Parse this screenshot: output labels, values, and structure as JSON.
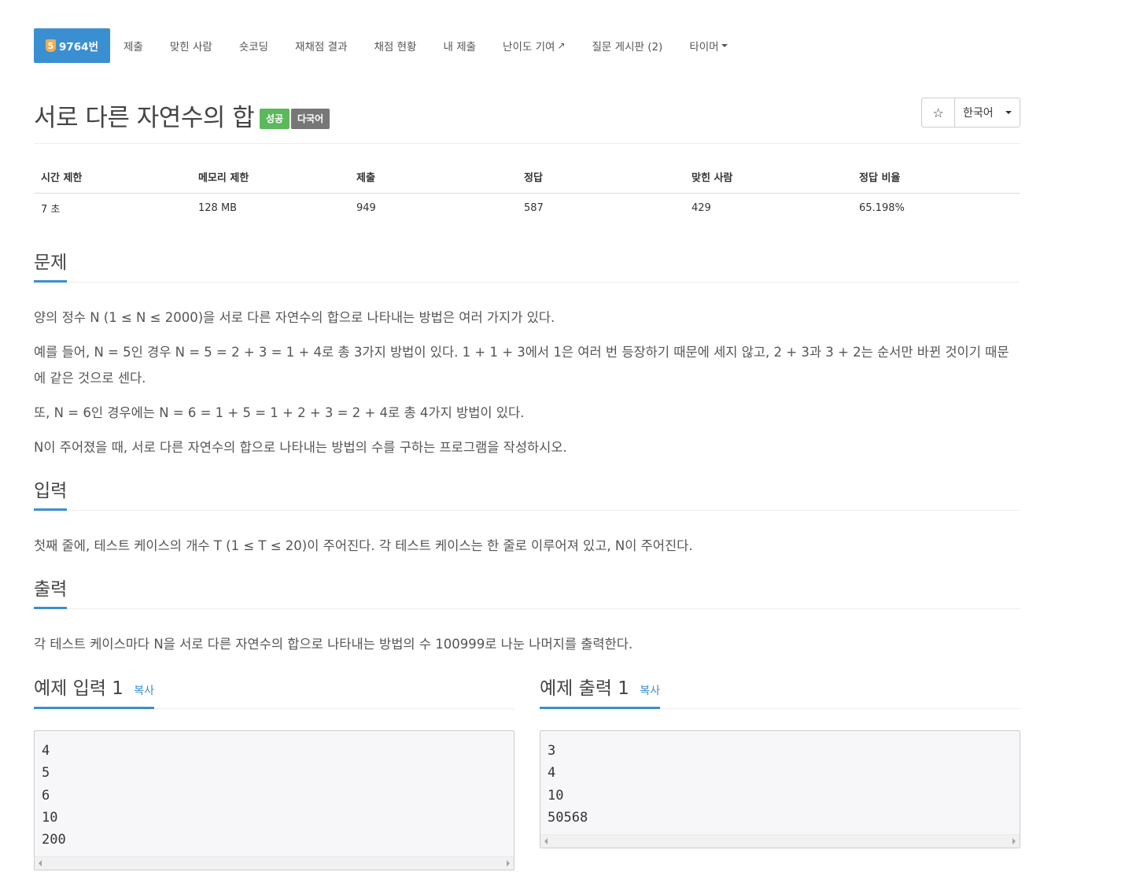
{
  "nav": {
    "problem_number_icon": "html5-shield-icon",
    "problem_number_icon_text": "5",
    "problem_number": "9764번",
    "items": [
      "제출",
      "맞힌 사람",
      "숏코딩",
      "재채점 결과",
      "채점 현황",
      "내 제출",
      "난이도 기여",
      "질문 게시판 (2)",
      "타이머"
    ]
  },
  "title": {
    "text": "서로 다른 자연수의 합",
    "badge_success": "성공",
    "badge_multilang": "다국어",
    "star": "☆",
    "language": "한국어"
  },
  "info": {
    "headers": [
      "시간 제한",
      "메모리 제한",
      "제출",
      "정답",
      "맞힌 사람",
      "정답 비율"
    ],
    "values": [
      "7 초",
      "128 MB",
      "949",
      "587",
      "429",
      "65.198%"
    ]
  },
  "problem": {
    "heading": "문제",
    "paragraphs": [
      "양의 정수 N (1 ≤ N ≤ 2000)을 서로 다른 자연수의 합으로 나타내는 방법은 여러 가지가 있다.",
      "예를 들어, N = 5인 경우 N = 5 = 2 + 3 = 1 + 4로 총 3가지 방법이 있다. 1 + 1 + 3에서 1은 여러 번 등장하기 때문에 세지 않고, 2 + 3과 3 + 2는 순서만 바뀐 것이기 때문에 같은 것으로 센다.",
      "또, N = 6인 경우에는 N = 6 = 1 + 5 = 1 + 2 + 3 = 2 + 4로 총 4가지 방법이 있다.",
      "N이 주어졌을 때, 서로 다른 자연수의 합으로 나타내는 방법의 수를 구하는 프로그램을 작성하시오."
    ]
  },
  "input": {
    "heading": "입력",
    "text": "첫째 줄에, 테스트 케이스의 개수 T (1 ≤ T ≤ 20)이 주어진다. 각 테스트 케이스는 한 줄로 이루어져 있고, N이 주어진다."
  },
  "output": {
    "heading": "출력",
    "text": "각 테스트 케이스마다 N을 서로 다른 자연수의 합으로 나타내는 방법의 수 100999로 나눈 나머지를 출력한다."
  },
  "samples": {
    "input_heading": "예제 입력 1",
    "output_heading": "예제 출력 1",
    "copy_label": "복사",
    "input_lines": [
      "4",
      "5",
      "6",
      "10",
      "200"
    ],
    "output_lines": [
      "3",
      "4",
      "10",
      "50568"
    ]
  }
}
